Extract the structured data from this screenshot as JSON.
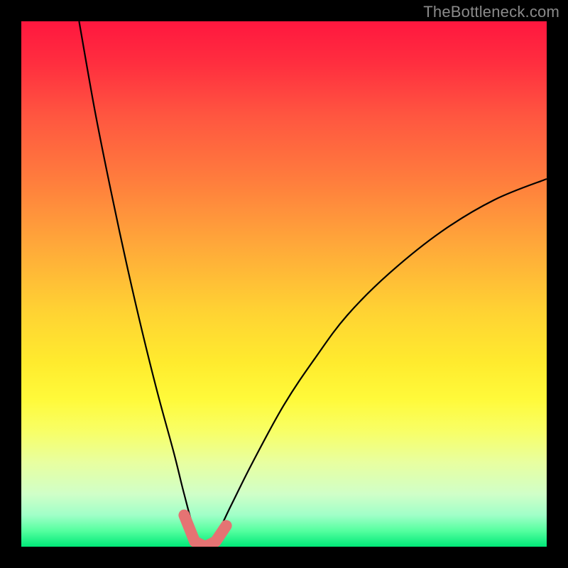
{
  "watermark": "TheBottleneck.com",
  "chart_data": {
    "type": "line",
    "title": "",
    "xlabel": "",
    "ylabel": "",
    "xlim": [
      0,
      100
    ],
    "ylim": [
      0,
      100
    ],
    "series": [
      {
        "name": "bottleneck-curve",
        "comment": "V-shaped bottleneck percentage curve; minimum ~0% around x≈33–37; rises steeply toward 100% as x→0 and smoothly toward ~70% as x→100.",
        "x": [
          11,
          14,
          17,
          20,
          23,
          26,
          29,
          31,
          33,
          35,
          37,
          40,
          44,
          50,
          56,
          62,
          70,
          80,
          90,
          100
        ],
        "y": [
          100,
          83,
          68,
          54,
          41,
          29,
          18,
          10,
          3,
          0,
          2,
          8,
          16,
          27,
          36,
          44,
          52,
          60,
          66,
          70
        ]
      },
      {
        "name": "fit-marker",
        "comment": "Thick salmon segment marking the near-zero bottleneck zone at the valley.",
        "x": [
          31,
          33,
          35,
          37,
          39
        ],
        "y": [
          6,
          1,
          0,
          1,
          4
        ]
      }
    ],
    "colors": {
      "curve": "#000000",
      "marker": "#e57373",
      "background_top": "#ff173f",
      "background_bottom": "#00e878",
      "frame": "#000000"
    }
  }
}
